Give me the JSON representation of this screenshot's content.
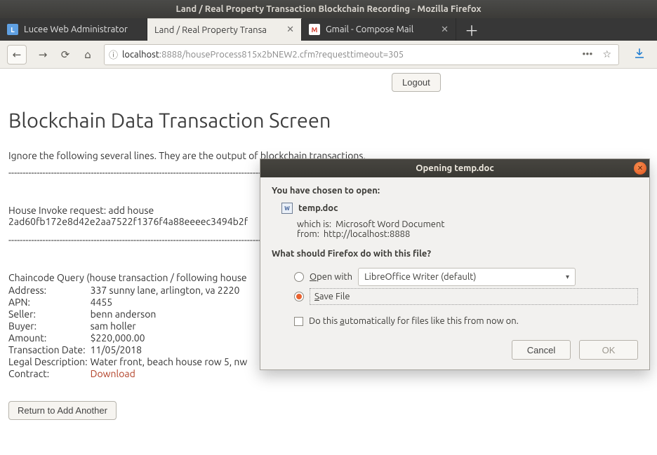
{
  "window": {
    "title": "Land / Real Property Transaction Blockchain Recording - Mozilla Firefox"
  },
  "tabs": [
    {
      "label": "Lucee Web Administrator",
      "active": false
    },
    {
      "label": "Land / Real Property Transa",
      "active": true
    },
    {
      "label": "Gmail - Compose Mail",
      "active": false,
      "favicon": "M"
    }
  ],
  "url": {
    "host": "localhost",
    "rest": ":8888/houseProcess815x2bNEW2.cfm?requesttimeout=305"
  },
  "page": {
    "logout": "Logout",
    "title": "Blockchain Data Transaction Screen",
    "note": "Ignore the following several lines. They are the output of blockchain transactions.",
    "dashes": "---------------------------------------------------------------------------------------------------------------------------------------",
    "invoke_label": "House Invoke request: add house",
    "invoke_hash": "2ad60fb172e8d42e2aa7522f1376f4a88eeeec3494b2f",
    "chaincode_intro": "Chaincode Query (house transaction / following house",
    "rows": [
      {
        "k": "Address:",
        "v": "337 sunny lane, arlington, va 2220"
      },
      {
        "k": "APN:",
        "v": "4455"
      },
      {
        "k": "Seller:",
        "v": "benn anderson"
      },
      {
        "k": "Buyer:",
        "v": "sam holler"
      },
      {
        "k": "Amount:",
        "v": "$220,000.00"
      },
      {
        "k": "Transaction Date:",
        "v": "11/05/2018"
      },
      {
        "k": "Legal Description:",
        "v": "Water front, beach house row 5, nw"
      },
      {
        "k": "Contract:",
        "v": "Download"
      }
    ],
    "return": "Return to Add Another"
  },
  "dialog": {
    "title": "Opening temp.doc",
    "intro": "You have chosen to open:",
    "filename": "temp.doc",
    "which_is_label": "which is:",
    "which_is_value": "Microsoft Word Document",
    "from_label": "from:",
    "from_value": "http://localhost:8888",
    "question": "What should Firefox do with this file?",
    "open_with_pre": "O",
    "open_with_post": "pen with",
    "open_with_app": "LibreOffice Writer (default)",
    "save_pre": "S",
    "save_post": "ave File",
    "auto_pre": "Do this ",
    "auto_u": "a",
    "auto_post": "utomatically for files like this from now on.",
    "cancel": "Cancel",
    "ok": "OK"
  }
}
